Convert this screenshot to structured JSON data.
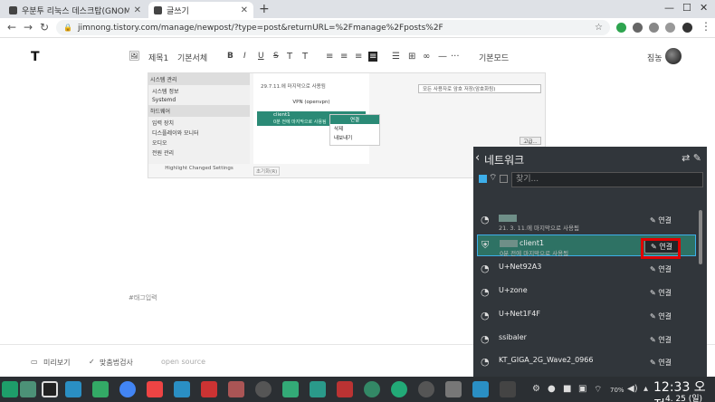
{
  "browser": {
    "tabs": [
      {
        "title": "우분투 리눅스 데스크탑(GNOM",
        "active": false
      },
      {
        "title": "글쓰기",
        "active": true
      }
    ],
    "new_tab": "+",
    "window_controls": {
      "minimize": "—",
      "maximize": "☐",
      "close": "✕"
    },
    "url": "jimnong.tistory.com/manage/newpost/?type=post&returnURL=%2Fmanage%2Fposts%2F"
  },
  "editor": {
    "logo": "T",
    "toolbar": {
      "image": "🖼",
      "heading": "제목1",
      "font": "기본서체",
      "bold": "B",
      "italic": "I",
      "underline": "U",
      "strike": "S",
      "mode": "기본모드"
    },
    "username": "짐농",
    "tag_placeholder": "#태그입력",
    "bottom": {
      "preview": "미리보기",
      "spellcheck": "맞춤법검사",
      "open_source": "open source"
    }
  },
  "embedded": {
    "section_system": "시스템 관리",
    "items_system": [
      "시스템 정보",
      "Systemd"
    ],
    "section_hardware": "하드웨어",
    "items_hardware": [
      "입력 장치",
      "디스플레이와 모니터",
      "오디오",
      "전원 관리"
    ],
    "footer": "Highlight Changed Settings",
    "wifi_item": "29.7.11.에 마지막으로 사용됨",
    "vpn_header": "VPN (openvpn)",
    "vpn_item_name": "client1",
    "vpn_item_sub": "0분 전에 마지막으로 사용됨",
    "menu": [
      "연결",
      "삭제",
      "내보내기"
    ],
    "select_text": "모든 사용자로 암호 저장(암호화됨)",
    "button": "고급...",
    "reset": "초기화(R)"
  },
  "network_panel": {
    "title": "네트워크",
    "search_placeholder": "찾기...",
    "connect_label": "연결",
    "networks": [
      {
        "name": "",
        "sub": "21. 3. 11.에 마지막으로 사용됨",
        "icon": "wifi-lock"
      },
      {
        "name": "client1",
        "sub": "0분 전에 마지막으로 사용됨",
        "icon": "vpn-shield",
        "highlighted": true
      },
      {
        "name": "U+Net92A3",
        "sub": "",
        "icon": "wifi-lock"
      },
      {
        "name": "U+zone",
        "sub": "",
        "icon": "wifi"
      },
      {
        "name": "U+Net1F4F",
        "sub": "",
        "icon": "wifi-lock"
      },
      {
        "name": "ssibaler",
        "sub": "",
        "icon": "wifi-lock"
      },
      {
        "name": "KT_GIGA_2G_Wave2_0966",
        "sub": "",
        "icon": "wifi-lock"
      }
    ]
  },
  "taskbar": {
    "clock": "12:33 오전",
    "date": "4. 25 (일)",
    "battery": "70%"
  },
  "colors": {
    "teal": "#2e7264",
    "panel_bg": "#31363b",
    "taskbar_bg": "#2b2f33",
    "highlight_red": "#e00000"
  }
}
